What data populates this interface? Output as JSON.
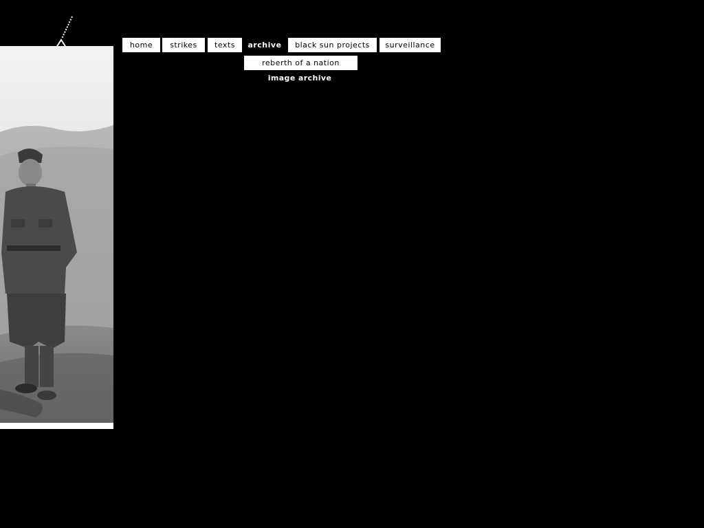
{
  "nav": {
    "home": "home",
    "strikes": "strikes",
    "texts": "texts",
    "archive": "archive",
    "black_sun_projects": "black sun projects",
    "surveillance": "surveillance"
  },
  "archive_menu": {
    "rebirth": "reberth of a nation",
    "image_archive": "image archive"
  },
  "logo": {
    "icon": "triangle-logo-icon"
  },
  "photo": {
    "subject": "soldier-photograph"
  },
  "colors": {
    "background": "#000000",
    "button": "#ffffff",
    "text": "#000000"
  }
}
